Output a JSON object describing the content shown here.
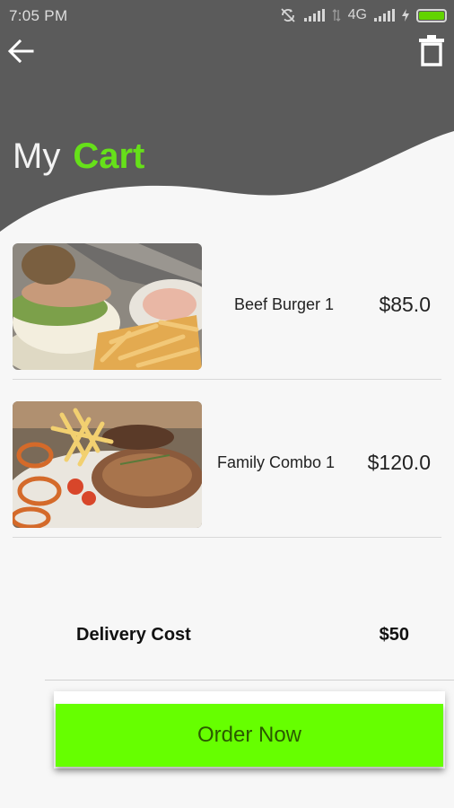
{
  "status_bar": {
    "time": "7:05  PM",
    "network": "4G"
  },
  "header": {
    "title_prefix": "My",
    "title_accent": "Cart"
  },
  "cart": {
    "items": [
      {
        "name": "Beef Burger 1",
        "price": "$85.0",
        "image": "beef-burger-photo"
      },
      {
        "name": "Family Combo 1",
        "price": "$120.0",
        "image": "family-combo-photo"
      }
    ]
  },
  "delivery": {
    "label": "Delivery Cost",
    "value": "$50"
  },
  "order": {
    "button_label": "Order Now"
  },
  "colors": {
    "header_bg": "#5b5b5b",
    "accent": "#66e019",
    "order_button": "#66ff00",
    "background": "#f7f7f7"
  },
  "icons": {
    "back": "arrow-left-icon",
    "trash": "trash-icon",
    "sync": "sync-off-icon",
    "signal": "signal-icon",
    "battery": "battery-icon"
  }
}
